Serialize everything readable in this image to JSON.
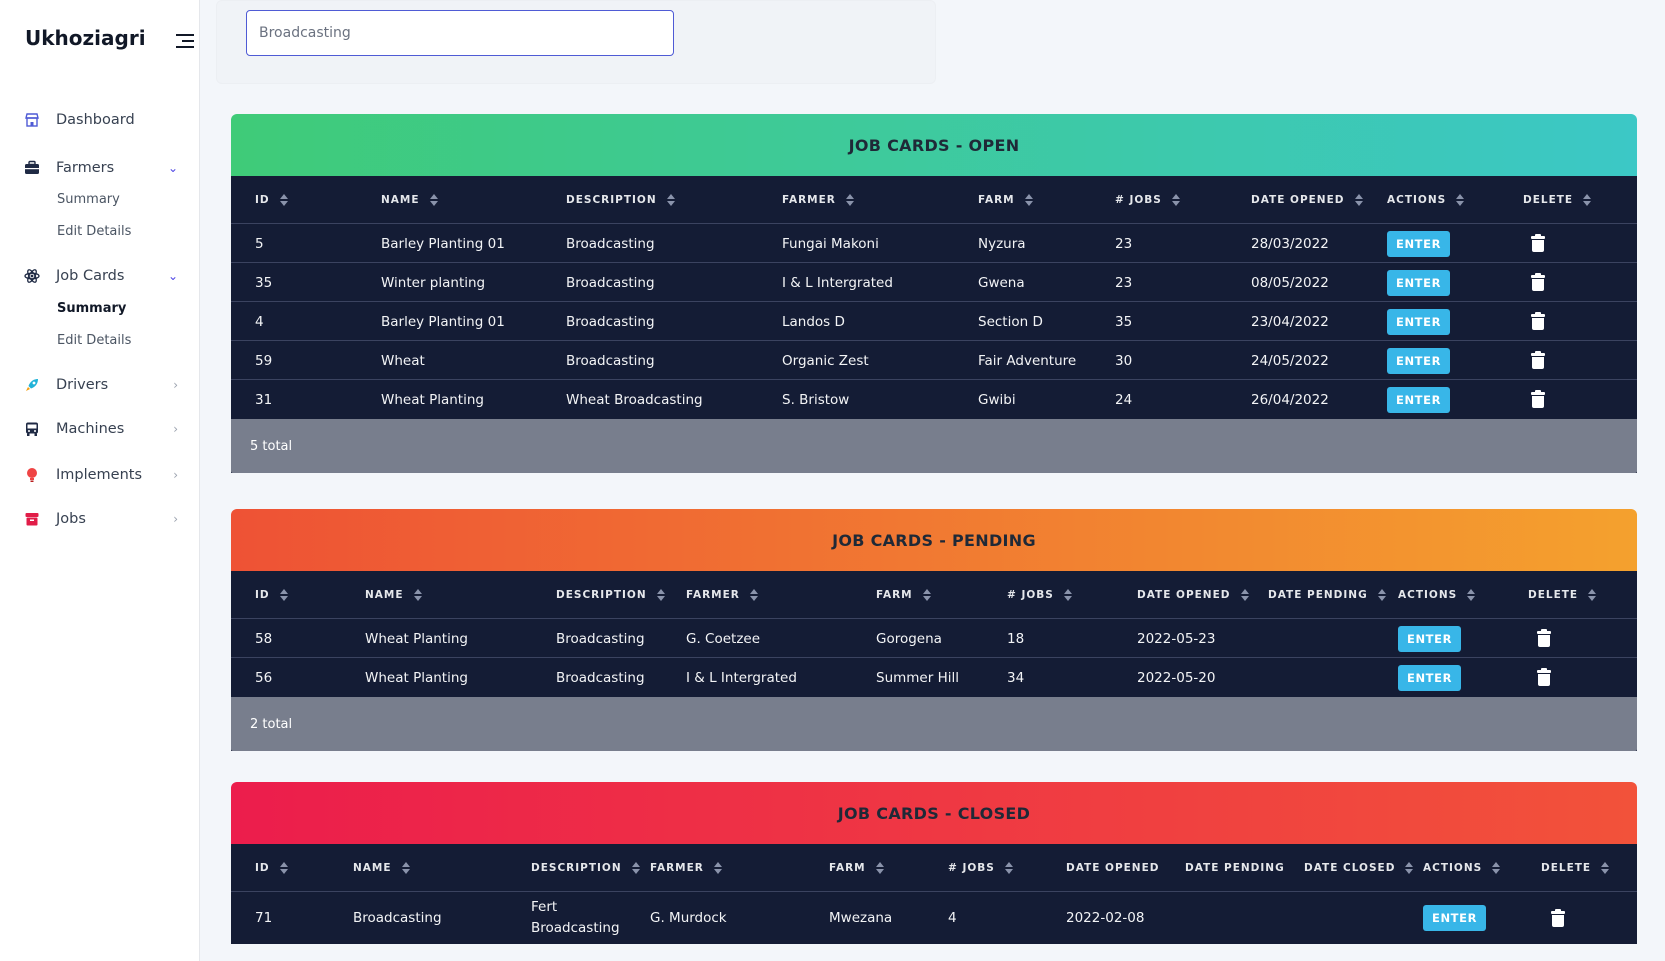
{
  "app": {
    "title": "Ukhoziagri"
  },
  "sidebar": {
    "items": [
      {
        "label": "Dashboard",
        "icon": "store-icon"
      },
      {
        "label": "Farmers",
        "icon": "briefcase-icon",
        "expanded": true,
        "children": [
          "Summary",
          "Edit Details"
        ]
      },
      {
        "label": "Job Cards",
        "icon": "atom-icon",
        "expanded": true,
        "children": [
          "Summary",
          "Edit Details"
        ]
      },
      {
        "label": "Drivers",
        "icon": "rocket-icon"
      },
      {
        "label": "Machines",
        "icon": "bus-icon"
      },
      {
        "label": "Implements",
        "icon": "bulb-icon"
      },
      {
        "label": "Jobs",
        "icon": "archive-icon"
      }
    ]
  },
  "search": {
    "value": "Broadcasting"
  },
  "open": {
    "title": "JOB CARDS - OPEN",
    "headers": [
      "ID",
      "NAME",
      "DESCRIPTION",
      "FARMER",
      "FARM",
      "# JOBS",
      "DATE OPENED",
      "ACTIONS",
      "DELETE"
    ],
    "rows": [
      [
        "5",
        "Barley Planting 01",
        "Broadcasting",
        "Fungai Makoni",
        "Nyzura",
        "23",
        "28/03/2022"
      ],
      [
        "35",
        "Winter planting",
        "Broadcasting",
        "I & L Intergrated",
        "Gwena",
        "23",
        "08/05/2022"
      ],
      [
        "4",
        "Barley Planting 01",
        "Broadcasting",
        "Landos D",
        "Section D",
        "35",
        "23/04/2022"
      ],
      [
        "59",
        "Wheat",
        "Broadcasting",
        "Organic Zest",
        "Fair Adventure",
        "30",
        "24/05/2022"
      ],
      [
        "31",
        "Wheat Planting",
        "Wheat Broadcasting",
        "S. Bristow",
        "Gwibi",
        "24",
        "26/04/2022"
      ]
    ],
    "total": "5 total",
    "enter_label": "ENTER"
  },
  "pending": {
    "title": "JOB CARDS - PENDING",
    "headers": [
      "ID",
      "NAME",
      "DESCRIPTION",
      "FARMER",
      "FARM",
      "# JOBS",
      "DATE OPENED",
      "DATE PENDING",
      "ACTIONS",
      "DELETE"
    ],
    "rows": [
      [
        "58",
        "Wheat Planting",
        "Broadcasting",
        "G. Coetzee",
        "Gorogena",
        "18",
        "2022-05-23",
        ""
      ],
      [
        "56",
        "Wheat Planting",
        "Broadcasting",
        "I & L Intergrated",
        "Summer Hill",
        "34",
        "2022-05-20",
        ""
      ]
    ],
    "total": "2 total",
    "enter_label": "ENTER"
  },
  "closed": {
    "title": "JOB CARDS - CLOSED",
    "headers": [
      "ID",
      "NAME",
      "DESCRIPTION",
      "FARMER",
      "FARM",
      "# JOBS",
      "DATE OPENED",
      "DATE PENDING",
      "DATE CLOSED",
      "ACTIONS",
      "DELETE"
    ],
    "rows": [
      [
        "71",
        "Broadcasting",
        "Fert Broadcasting",
        "G. Murdock",
        "Mwezana",
        "4",
        "2022-02-08",
        "",
        ""
      ]
    ],
    "enter_label": "ENTER"
  },
  "colors": {
    "accent": "#4f46e5",
    "table_bg": "#141c35",
    "enter_btn": "#38b6e8"
  }
}
